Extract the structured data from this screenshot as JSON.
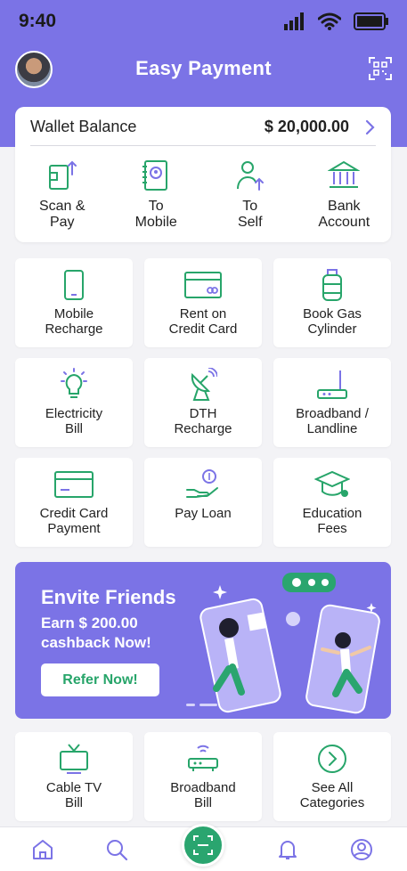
{
  "status": {
    "time": "9:40"
  },
  "app": {
    "title": "Easy Payment"
  },
  "wallet": {
    "label": "Wallet Balance",
    "amount": "$ 20,000.00"
  },
  "quick_actions": [
    {
      "label": "Scan &\nPay",
      "icon": "scan-pay-icon"
    },
    {
      "label": "To\nMobile",
      "icon": "contact-book-icon"
    },
    {
      "label": "To\nSelf",
      "icon": "user-transfer-icon"
    },
    {
      "label": "Bank\nAccount",
      "icon": "bank-icon"
    }
  ],
  "services": [
    {
      "label": "Mobile\nRecharge",
      "icon": "mobile-icon"
    },
    {
      "label": "Rent on\nCredit Card",
      "icon": "credit-card-icon"
    },
    {
      "label": "Book Gas\nCylinder",
      "icon": "gas-cylinder-icon"
    },
    {
      "label": "Electricity\nBill",
      "icon": "bulb-icon"
    },
    {
      "label": "DTH\nRecharge",
      "icon": "satellite-dish-icon"
    },
    {
      "label": "Broadband /\nLandline",
      "icon": "router-icon"
    },
    {
      "label": "Credit Card\nPayment",
      "icon": "credit-card-icon"
    },
    {
      "label": "Pay Loan",
      "icon": "loan-hand-icon"
    },
    {
      "label": "Education\nFees",
      "icon": "graduation-cap-icon"
    }
  ],
  "banner": {
    "title": "Envite Friends",
    "subtitle": "Earn $ 200.00 cashback Now!",
    "button": "Refer Now!"
  },
  "more_services": [
    {
      "label": "Cable TV\nBill",
      "icon": "tv-icon"
    },
    {
      "label": "Broadband\nBill",
      "icon": "router-icon"
    },
    {
      "label": "See All\nCategories",
      "icon": "chevron-circle-icon"
    }
  ],
  "colors": {
    "primary": "#7b73e6",
    "accent_green": "#2aa56f",
    "icon_purple": "#7b73e6",
    "icon_green": "#27a56a"
  }
}
